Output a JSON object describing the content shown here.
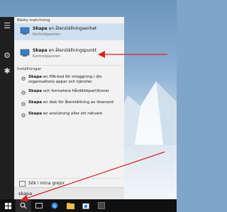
{
  "panel": {
    "best_match_header": "Bästa matchning",
    "results": [
      {
        "query": "Skapa",
        "rest": " en återställningsenhet",
        "subtitle": "Kontrollpanelen"
      },
      {
        "query": "Skapa",
        "rest": " en återställningspunkt",
        "subtitle": "Kontrollpanelen"
      }
    ],
    "settings_header": "Inställningar",
    "settings": [
      {
        "query": "Skapa",
        "rest": " en PIN-kod för inloggning i din organisations appar och tjänster."
      },
      {
        "query": "Skapa",
        "rest": " och formatera hårddiskpartitioner"
      },
      {
        "query": "Skapa",
        "rest": " en disk för återställning av lösenord"
      },
      {
        "query": "Skapa",
        "rest": " en anslutning eller ett nätverk"
      }
    ],
    "my_stuff": "Sök i mina grejor",
    "search_value": "skapa"
  },
  "rail": {
    "icons": [
      "hamburger-menu-icon",
      "settings-gear-icon",
      "hint-icon"
    ]
  },
  "taskbar": {
    "icons": [
      "windows-start-icon",
      "search-icon",
      "task-view-icon",
      "edge-browser-icon",
      "file-explorer-icon",
      "store-icon",
      "app-icon"
    ]
  },
  "colors": {
    "highlight": "#cfe1f1",
    "arrow": "#e02020",
    "taskbar": "#101010"
  }
}
